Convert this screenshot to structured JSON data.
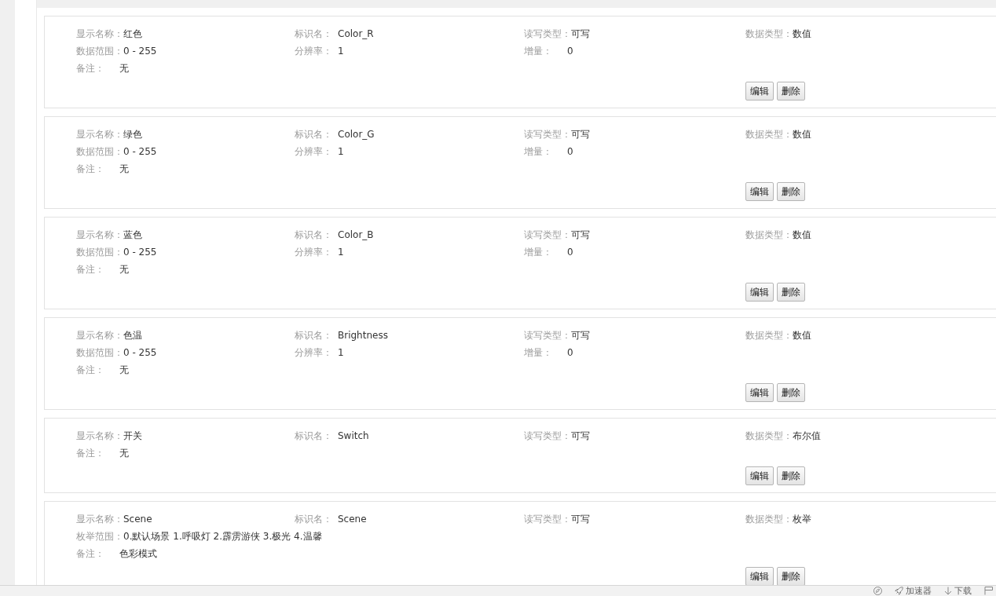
{
  "cards": [
    {
      "columns": [
        {
          "fields": [
            {
              "label": "显示名称：",
              "value": "红色"
            },
            {
              "label": "数据范围：",
              "value": "0 - 255"
            },
            {
              "label": "备注：",
              "value": "无"
            }
          ]
        },
        {
          "fields": [
            {
              "label": "标识名：",
              "value": "Color_R"
            },
            {
              "label": "分辨率：",
              "value": "1"
            }
          ]
        },
        {
          "fields": [
            {
              "label": "读写类型：",
              "value": "可写"
            },
            {
              "label": "增量：",
              "value": "0"
            }
          ]
        },
        {
          "fields": [
            {
              "label": "数据类型：",
              "value": "数值"
            }
          ]
        }
      ],
      "buttons": [
        "编辑",
        "删除"
      ]
    },
    {
      "columns": [
        {
          "fields": [
            {
              "label": "显示名称：",
              "value": "绿色"
            },
            {
              "label": "数据范围：",
              "value": "0 - 255"
            },
            {
              "label": "备注：",
              "value": "无"
            }
          ]
        },
        {
          "fields": [
            {
              "label": "标识名：",
              "value": "Color_G"
            },
            {
              "label": "分辨率：",
              "value": "1"
            }
          ]
        },
        {
          "fields": [
            {
              "label": "读写类型：",
              "value": "可写"
            },
            {
              "label": "增量：",
              "value": "0"
            }
          ]
        },
        {
          "fields": [
            {
              "label": "数据类型：",
              "value": "数值"
            }
          ]
        }
      ],
      "buttons": [
        "编辑",
        "删除"
      ]
    },
    {
      "columns": [
        {
          "fields": [
            {
              "label": "显示名称：",
              "value": "蓝色"
            },
            {
              "label": "数据范围：",
              "value": "0 - 255"
            },
            {
              "label": "备注：",
              "value": "无"
            }
          ]
        },
        {
          "fields": [
            {
              "label": "标识名：",
              "value": "Color_B"
            },
            {
              "label": "分辨率：",
              "value": "1"
            }
          ]
        },
        {
          "fields": [
            {
              "label": "读写类型：",
              "value": "可写"
            },
            {
              "label": "增量：",
              "value": "0"
            }
          ]
        },
        {
          "fields": [
            {
              "label": "数据类型：",
              "value": "数值"
            }
          ]
        }
      ],
      "buttons": [
        "编辑",
        "删除"
      ]
    },
    {
      "columns": [
        {
          "fields": [
            {
              "label": "显示名称：",
              "value": "色温"
            },
            {
              "label": "数据范围：",
              "value": "0 - 255"
            },
            {
              "label": "备注：",
              "value": "无"
            }
          ]
        },
        {
          "fields": [
            {
              "label": "标识名：",
              "value": "Brightness"
            },
            {
              "label": "分辨率：",
              "value": "1"
            }
          ]
        },
        {
          "fields": [
            {
              "label": "读写类型：",
              "value": "可写"
            },
            {
              "label": "增量：",
              "value": "0"
            }
          ]
        },
        {
          "fields": [
            {
              "label": "数据类型：",
              "value": "数值"
            }
          ]
        }
      ],
      "buttons": [
        "编辑",
        "删除"
      ]
    },
    {
      "columns": [
        {
          "fields": [
            {
              "label": "显示名称：",
              "value": "开关"
            },
            {
              "label": "备注：",
              "value": "无"
            }
          ]
        },
        {
          "fields": [
            {
              "label": "标识名：",
              "value": "Switch"
            }
          ]
        },
        {
          "fields": [
            {
              "label": "读写类型：",
              "value": "可写"
            }
          ]
        },
        {
          "fields": [
            {
              "label": "数据类型：",
              "value": "布尔值"
            }
          ]
        }
      ],
      "buttons": [
        "编辑",
        "删除"
      ]
    },
    {
      "columns": [
        {
          "fields": [
            {
              "label": "显示名称：",
              "value": "Scene"
            },
            {
              "label": "枚举范围：",
              "value": "0.默认场景 1.呼吸灯 2.霹雳游侠 3.极光 4.温馨"
            },
            {
              "label": "备注：",
              "value": "色彩模式"
            }
          ]
        },
        {
          "fields": [
            {
              "label": "标识名：",
              "value": "Scene"
            }
          ]
        },
        {
          "fields": [
            {
              "label": "读写类型：",
              "value": "可写"
            }
          ]
        },
        {
          "fields": [
            {
              "label": "数据类型：",
              "value": "枚举"
            }
          ]
        }
      ],
      "buttons": [
        "编辑",
        "删除"
      ]
    }
  ],
  "status_bar": {
    "accelerator": "加速器",
    "download": "下载"
  }
}
